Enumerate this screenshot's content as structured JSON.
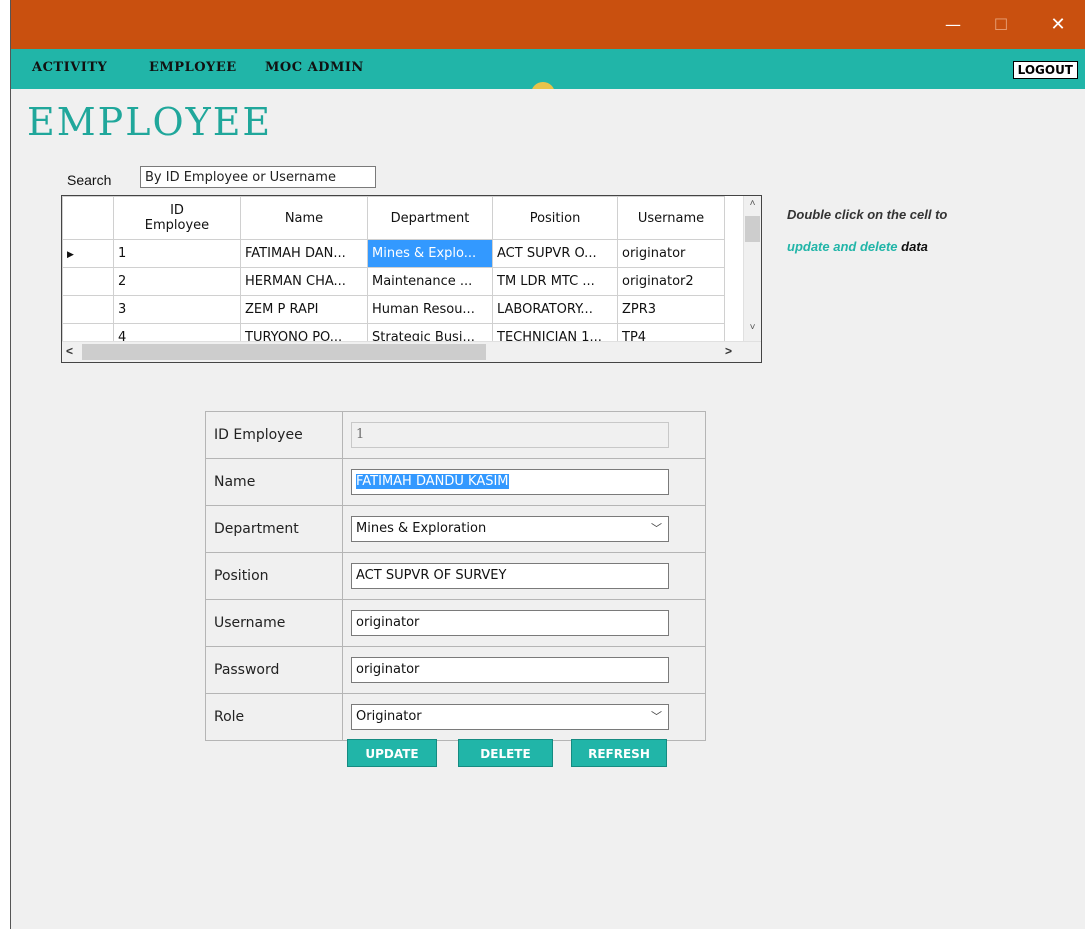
{
  "window": {
    "minimize_glyph": "—",
    "maximize_glyph": "☐",
    "close_glyph": "✕"
  },
  "menu": {
    "items": [
      "ACTIVITY",
      "EMPLOYEE",
      "MOC ADMIN"
    ],
    "logout_label": "LOGOUT"
  },
  "page": {
    "title": "EMPLOYEE"
  },
  "search": {
    "label": "Search",
    "value": "By ID Employee or Username"
  },
  "grid": {
    "columns": [
      "ID Employee",
      "Name",
      "Department",
      "Position",
      "Username"
    ],
    "rows": [
      [
        "1",
        "FATIMAH DAN...",
        "Mines & Explo...",
        "ACT SUPVR O...",
        "originator"
      ],
      [
        "2",
        "HERMAN CHA...",
        "Maintenance ...",
        "TM LDR MTC ...",
        "originator2"
      ],
      [
        "3",
        "ZEM P RAPI",
        "Human Resou...",
        "LABORATORY...",
        "ZPR3"
      ],
      [
        "4",
        "TURYONO PO...",
        "Strategic Busi...",
        "TECHNICIAN 1...",
        "TP4"
      ]
    ],
    "current_row_marker": "▶",
    "scroll_up": "˄",
    "scroll_down": "˅",
    "scroll_left": "<",
    "scroll_right": ">"
  },
  "hint": {
    "line1": "Double click on the cell to",
    "accent": "update and delete",
    "rest": " data"
  },
  "form": {
    "id_label": "ID Employee",
    "id_value": "1",
    "name_label": "Name",
    "name_value": "FATIMAH DANDU KASIM",
    "department_label": "Department",
    "department_value": "Mines & Exploration",
    "position_label": "Position",
    "position_value": "ACT SUPVR OF SURVEY",
    "username_label": "Username",
    "username_value": "originator",
    "password_label": "Password",
    "password_value": "originator",
    "role_label": "Role",
    "role_value": "Originator",
    "dropdown_glyph": "﹀"
  },
  "buttons": {
    "update": "UPDATE",
    "delete": "DELETE",
    "refresh": "REFRESH"
  },
  "colors": {
    "titlebar": "#c9500f",
    "menubar": "#21b5a8",
    "accent": "#20a79b",
    "selection": "#3399ff"
  }
}
